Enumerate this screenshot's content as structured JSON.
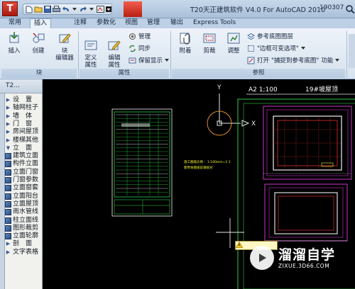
{
  "window": {
    "title": "T20天正建筑软件 V4.0 For AutoCAD 2010",
    "code": "190307"
  },
  "tabs": [
    "常用",
    "插入",
    "注释",
    "参数化",
    "视图",
    "管理",
    "输出",
    "Express Tools"
  ],
  "active_tab": "插入",
  "ribbon": {
    "block_panel": {
      "label": "块",
      "insert": "插入",
      "create": "创建",
      "block_editor_1": "块",
      "block_editor_2": "编辑器"
    },
    "attr_panel": {
      "label": "属性",
      "define_1": "定义",
      "define_2": "属性",
      "edit_1": "编辑",
      "edit_2": "属性",
      "manage": "管理",
      "sync": "同步",
      "keep_display": "保留显示"
    },
    "ref_panel": {
      "label": "参照",
      "attach": "附着",
      "clip": "剪裁",
      "adjust": "调整",
      "underlay_layers": "参考底图图层",
      "frame_var": "\"边框可变选项\"",
      "open_label": "打开",
      "snap_ref": "\"捕捉到参考底图\"",
      "function_label": "功能"
    }
  },
  "palette": {
    "title": "T2...",
    "items": [
      {
        "label": "设　置",
        "type": "tri"
      },
      {
        "label": "轴网柱子",
        "type": "tri"
      },
      {
        "label": "墙　体",
        "type": "tri"
      },
      {
        "label": "门　窗",
        "type": "tri"
      },
      {
        "label": "房间屋顶",
        "type": "tri"
      },
      {
        "label": "楼梯其他",
        "type": "tri"
      },
      {
        "label": "立　面",
        "type": "open"
      },
      {
        "label": "建筑立面",
        "type": "icon"
      },
      {
        "label": "构件立面",
        "type": "icon"
      },
      {
        "label": "立面门窗",
        "type": "icon"
      },
      {
        "label": "门窗参数",
        "type": "icon"
      },
      {
        "label": "立面窗套",
        "type": "icon"
      },
      {
        "label": "立面阳台",
        "type": "icon"
      },
      {
        "label": "立面屋顶",
        "type": "icon"
      },
      {
        "label": "雨水管线",
        "type": "icon"
      },
      {
        "label": "柱立面线",
        "type": "icon"
      },
      {
        "label": "图形裁剪",
        "type": "icon"
      },
      {
        "label": "立面轮廓",
        "type": "icon"
      },
      {
        "label": "剖　面",
        "type": "tri"
      },
      {
        "label": "文字表格",
        "type": "tri"
      }
    ]
  },
  "drawing": {
    "sheet_scale": "A2  1;100",
    "sheet_title": "19#坡屋顶",
    "axis_y": "Y",
    "axis_x": "X",
    "note_1": "施工图纸比例 ：1:100mm=1:1",
    "note_2": "使用本图纸前请核对"
  },
  "watermark": {
    "title": "溜溜自学",
    "url": "ZIXUE.3D66.COM"
  }
}
